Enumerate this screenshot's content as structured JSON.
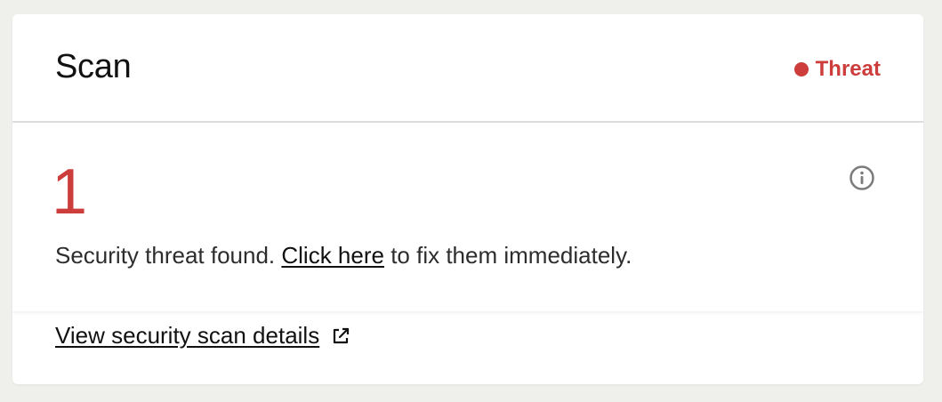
{
  "header": {
    "title": "Scan",
    "status_label": "Threat",
    "status_color": "#cc3d3b"
  },
  "body": {
    "threat_count": "1",
    "message_prefix": "Security threat found.",
    "message_link": "Click here",
    "message_suffix": "to fix them immediately.",
    "info_icon": "info-circle-icon"
  },
  "footer": {
    "details_link": "View security scan details",
    "external_icon": "external-link-icon"
  }
}
